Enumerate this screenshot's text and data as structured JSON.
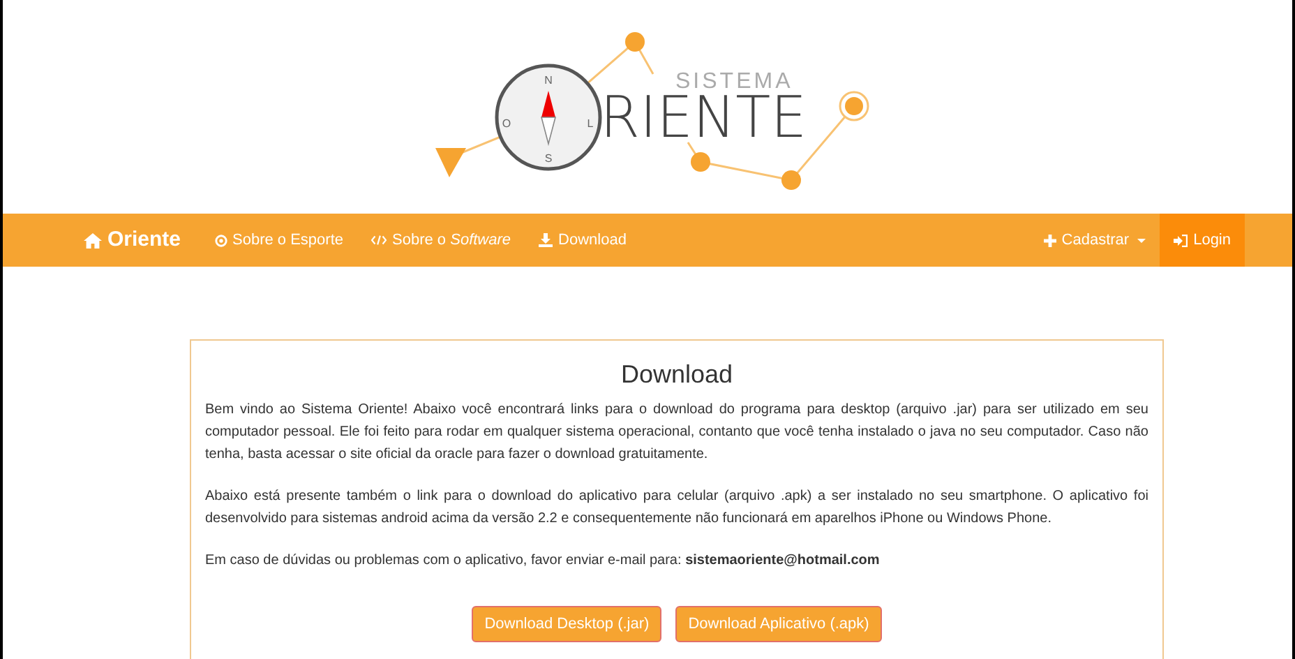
{
  "logo": {
    "compass_letters": [
      "N",
      "O",
      "L",
      "S"
    ],
    "subtitle": "SISTEMA",
    "title": "RIENTE"
  },
  "navbar": {
    "brand": "Oriente",
    "left_items": [
      {
        "label": "Sobre o Esporte"
      },
      {
        "label": "Sobre o *Software*"
      },
      {
        "label": "Download"
      }
    ],
    "right_items": [
      {
        "label": "Cadastrar",
        "dropdown": true,
        "selected": false
      },
      {
        "label": "Login",
        "dropdown": false,
        "selected": true
      }
    ]
  },
  "panel": {
    "title": "Download",
    "paragraphs": [
      "Bem vindo ao Sistema Oriente! Abaixo você encontrará links para o download do programa para desktop (arquivo .jar) para ser utilizado em seu computador pessoal. Ele foi feito para rodar em qualquer sistema operacional, contanto que você tenha instalado o java no seu computador. Caso não tenha, basta acessar o site oficial da oracle para fazer o download gratuitamente.",
      "Abaixo está presente também o link para o download do aplicativo para celular (arquivo .apk) a ser instalado no seu smartphone. O aplicativo foi desenvolvido para sistemas android acima da versão 2.2 e consequentemente não funcionará em aparelhos iPhone ou Windows Phone.",
      "Em caso de dúvidas ou problemas com o aplicativo, favor enviar e-mail para: **sistemaoriente@hotmail.com**"
    ],
    "buttons": [
      "Download Desktop (.jar)",
      "Download Aplicativo (.apk)"
    ]
  }
}
